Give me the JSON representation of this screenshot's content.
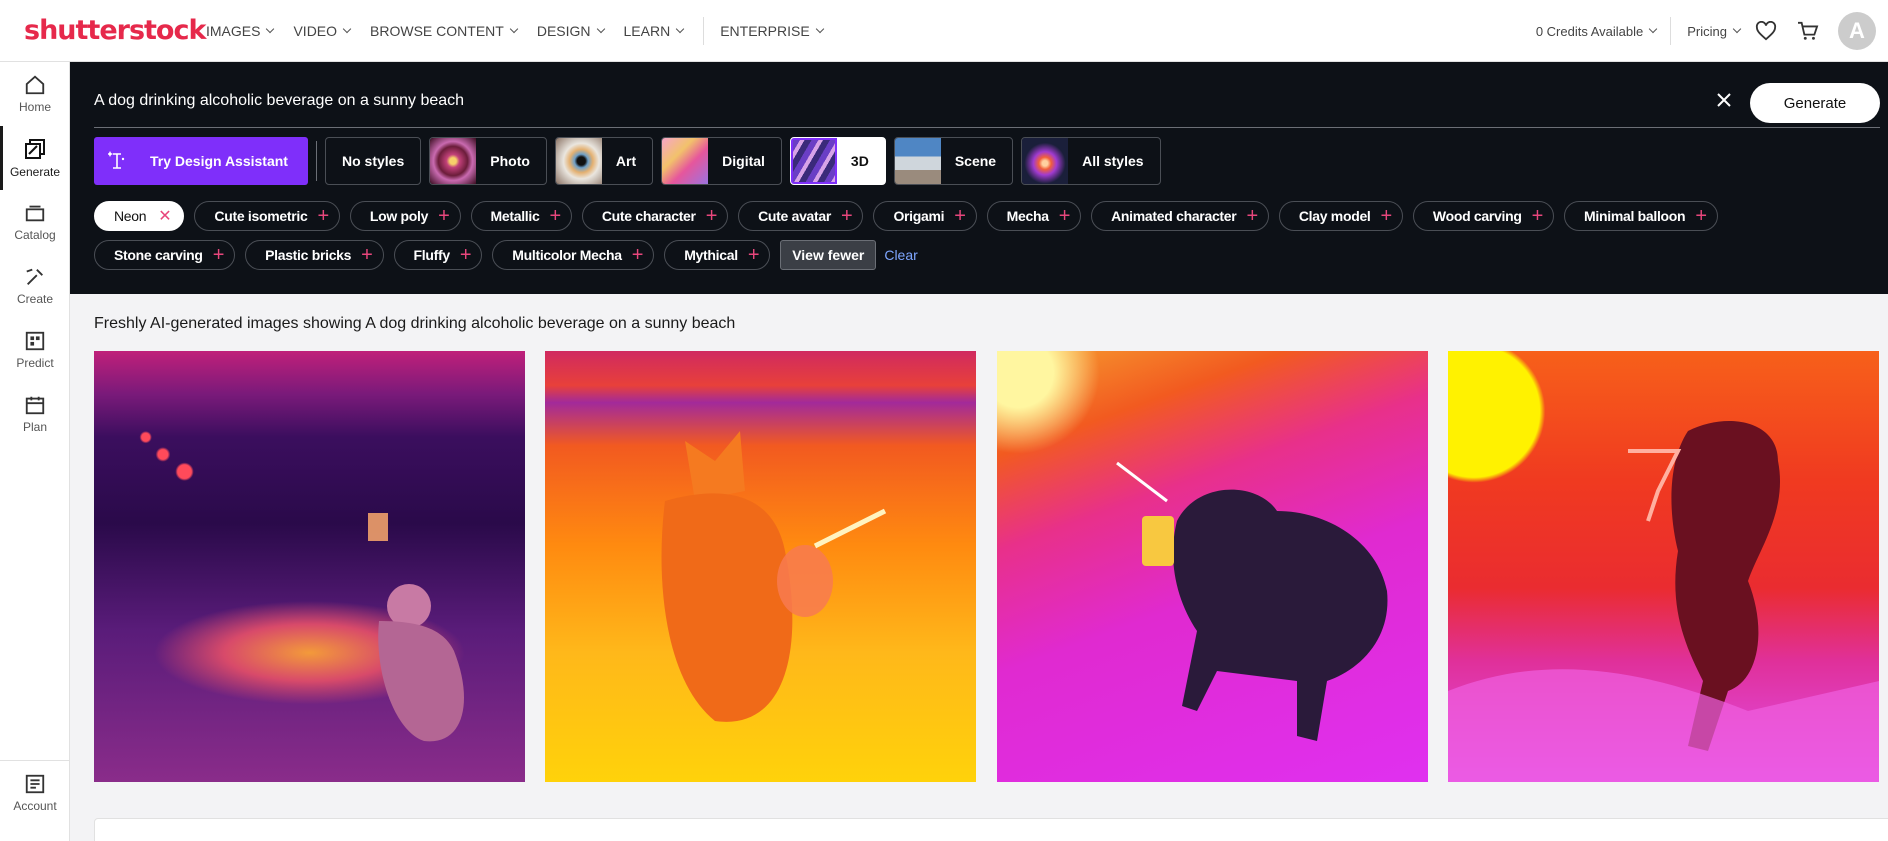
{
  "brand": {
    "logo_text": "shutterstock",
    "color": "#e6294b"
  },
  "nav": {
    "items": [
      {
        "label": "IMAGES"
      },
      {
        "label": "VIDEO"
      },
      {
        "label": "BROWSE CONTENT"
      },
      {
        "label": "DESIGN"
      },
      {
        "label": "LEARN"
      }
    ],
    "enterprise": "ENTERPRISE",
    "credits": "0 Credits Available",
    "pricing": "Pricing",
    "avatar_initial": "A"
  },
  "sidebar": {
    "items": [
      {
        "label": "Home",
        "icon": "home-icon"
      },
      {
        "label": "Generate",
        "icon": "generate-icon",
        "active": true
      },
      {
        "label": "Catalog",
        "icon": "catalog-icon"
      },
      {
        "label": "Create",
        "icon": "create-icon"
      },
      {
        "label": "Predict",
        "icon": "predict-icon"
      },
      {
        "label": "Plan",
        "icon": "plan-icon"
      }
    ],
    "account": "Account"
  },
  "prompt": {
    "text": "A dog drinking alcoholic beverage on a sunny beach",
    "generate_label": "Generate"
  },
  "styles": {
    "try_label": "Try Design Assistant",
    "accent": "#7f2ffa",
    "items": [
      {
        "label": "No styles"
      },
      {
        "label": "Photo"
      },
      {
        "label": "Art"
      },
      {
        "label": "Digital"
      },
      {
        "label": "3D",
        "active": true
      },
      {
        "label": "Scene"
      },
      {
        "label": "All styles"
      }
    ]
  },
  "chips": {
    "selected": "Neon",
    "row1": [
      "Cute isometric",
      "Low poly",
      "Metallic",
      "Cute character",
      "Cute avatar",
      "Origami",
      "Mecha",
      "Animated character",
      "Clay model",
      "Wood carving",
      "Minimal balloon"
    ],
    "row2": [
      "Stone carving",
      "Plastic bricks",
      "Fluffy",
      "Multicolor Mecha",
      "Mythical"
    ],
    "view_fewer": "View fewer",
    "clear": "Clear"
  },
  "results": {
    "title": "Freshly AI-generated images showing A dog drinking alcoholic beverage on a sunny beach"
  }
}
